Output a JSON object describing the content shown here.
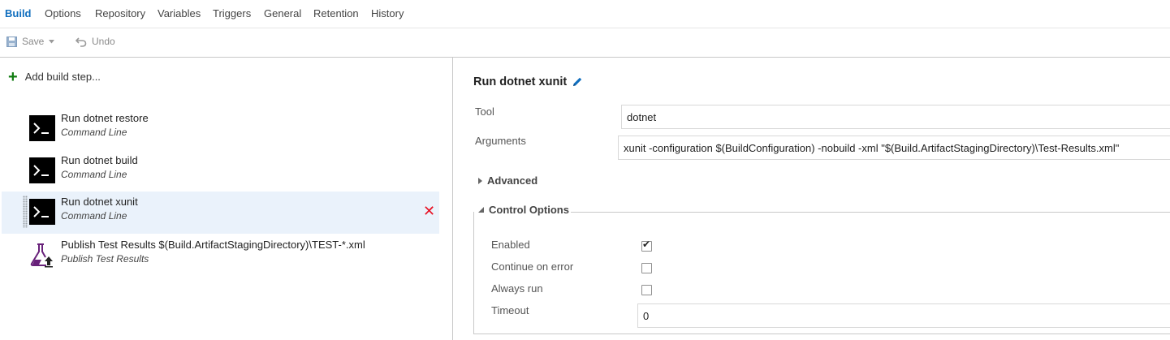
{
  "tabs": [
    "Build",
    "Options",
    "Repository",
    "Variables",
    "Triggers",
    "General",
    "Retention",
    "History"
  ],
  "toolbar": {
    "save_label": "Save",
    "undo_label": "Undo"
  },
  "left": {
    "add_step_label": "Add build step...",
    "steps": [
      {
        "title": "Run dotnet restore",
        "subtitle": "Command Line",
        "icon": "command-line-icon"
      },
      {
        "title": "Run dotnet build",
        "subtitle": "Command Line",
        "icon": "command-line-icon"
      },
      {
        "title": "Run dotnet xunit",
        "subtitle": "Command Line",
        "icon": "command-line-icon",
        "selected": true
      },
      {
        "title": "Publish Test Results $(Build.ArtifactStagingDirectory)\\TEST-*.xml",
        "subtitle": "Publish Test Results",
        "icon": "flask-upload-icon"
      }
    ]
  },
  "detail": {
    "title": "Run dotnet xunit",
    "tool_label": "Tool",
    "tool_value": "dotnet",
    "arguments_label": "Arguments",
    "arguments_value": "xunit -configuration $(BuildConfiguration) -nobuild -xml \"$(Build.ArtifactStagingDirectory)\\Test-Results.xml\"",
    "advanced_label": "Advanced",
    "control_options_label": "Control Options",
    "enabled_label": "Enabled",
    "enabled_checked": true,
    "continue_label": "Continue on error",
    "continue_checked": false,
    "always_run_label": "Always run",
    "always_run_checked": false,
    "timeout_label": "Timeout",
    "timeout_value": "0"
  },
  "colors": {
    "accent": "#106ebe",
    "add": "#107c10",
    "delete": "#e81123",
    "selected_bg": "#eaf2fb",
    "publish_icon": "#68217a"
  }
}
